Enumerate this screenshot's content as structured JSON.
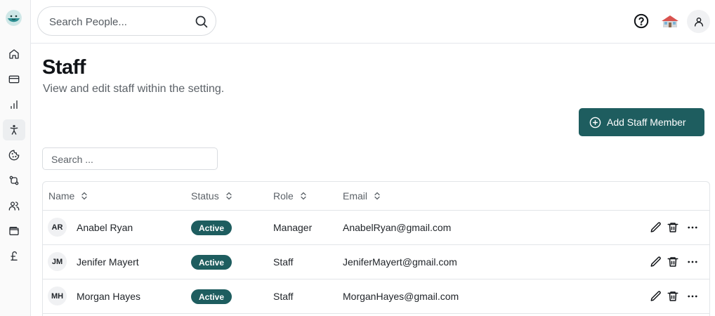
{
  "topbar": {
    "search_placeholder": "Search People..."
  },
  "sidebar": {
    "items": [
      {
        "icon": "home-icon"
      },
      {
        "icon": "credit-card-icon"
      },
      {
        "icon": "bar-chart-icon"
      },
      {
        "icon": "accessibility-icon",
        "active": true
      },
      {
        "icon": "cookie-icon"
      },
      {
        "icon": "git-compare-icon"
      },
      {
        "icon": "users-icon"
      },
      {
        "icon": "wallet-icon"
      },
      {
        "icon": "pound-sterling-icon"
      }
    ]
  },
  "page": {
    "title": "Staff",
    "subtitle": "View and edit staff within the setting.",
    "add_button_label": "Add Staff Member",
    "search_placeholder": "Search ..."
  },
  "table": {
    "columns": [
      "Name",
      "Status",
      "Role",
      "Email"
    ],
    "rows": [
      {
        "initials": "AR",
        "name": "Anabel Ryan",
        "status": "Active",
        "role": "Manager",
        "email": "AnabelRyan@gmail.com"
      },
      {
        "initials": "JM",
        "name": "Jenifer Mayert",
        "status": "Active",
        "role": "Staff",
        "email": "JeniferMayert@gmail.com"
      },
      {
        "initials": "MH",
        "name": "Morgan Hayes",
        "status": "Active",
        "role": "Staff",
        "email": "MorganHayes@gmail.com"
      }
    ]
  },
  "colors": {
    "accent": "#1e5d5f",
    "border": "#e2e5e8",
    "muted_text": "#5c6268"
  }
}
